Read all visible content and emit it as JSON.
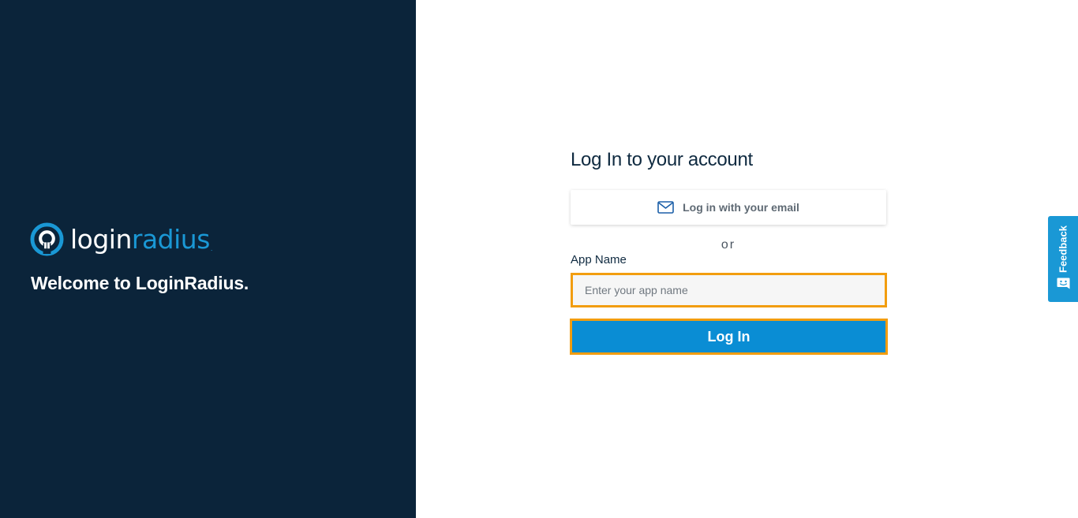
{
  "brand": {
    "name_part1": "login",
    "name_part2": "radius",
    "trademark_dot": ".",
    "welcome_text": "Welcome to LoginRadius.",
    "colors": {
      "panel_bg": "#0b243a",
      "accent": "#1a98d5"
    }
  },
  "login_form": {
    "title": "Log In to your account",
    "email_button_label": "Log in with your email",
    "email_button_icon": "mail-icon",
    "or_text": "or",
    "app_name_label": "App Name",
    "app_name_placeholder": "Enter your app name",
    "app_name_value": "",
    "submit_label": "Log In",
    "colors": {
      "submit_bg": "#0a8dd4",
      "focus_outline": "#f29d0f"
    }
  },
  "feedback_tab": {
    "label": "Feedback",
    "icon": "smiley-chat-icon"
  }
}
